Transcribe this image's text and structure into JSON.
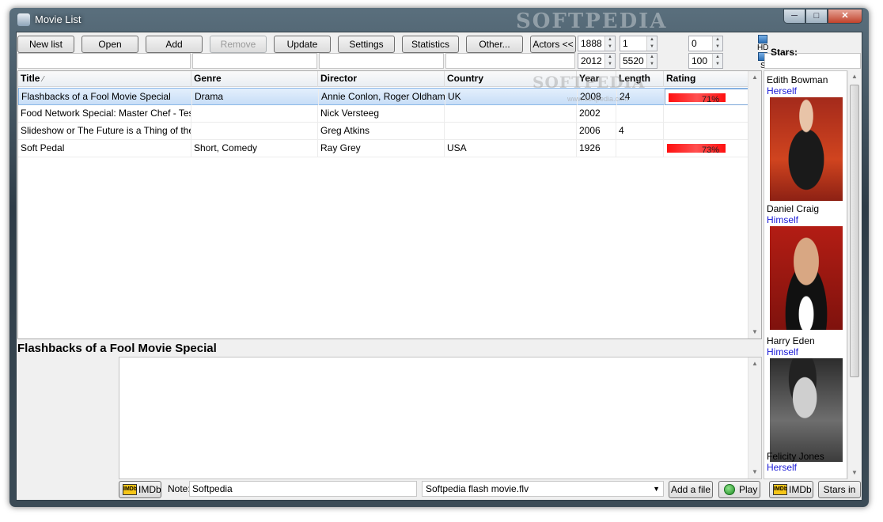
{
  "window": {
    "title": "Movie List",
    "watermark": "SOFTPEDIA",
    "caption": {
      "minimize": "─",
      "maximize": "□",
      "close": "✕"
    }
  },
  "toolbar": {
    "new_list": "New list",
    "open": "Open",
    "add": "Add",
    "remove": "Remove",
    "update": "Update",
    "settings": "Settings",
    "statistics": "Statistics",
    "other": "Other...",
    "actors": "Actors <<"
  },
  "filters": {
    "year_from": "1888",
    "year_to": "2012",
    "length_from": "1",
    "length_to": "5520",
    "rating_from": "0",
    "rating_to": "100",
    "hd_label": "HD",
    "s_label": "S"
  },
  "grid": {
    "columns": [
      "Title",
      "Genre",
      "Director",
      "Country",
      "Year",
      "Length",
      "Rating"
    ],
    "sort_indicator": "⁄",
    "rows": [
      {
        "title": "Flashbacks of a Fool Movie Special",
        "genre": "Drama",
        "director": "Annie Conlon, Roger Oldham",
        "country": "UK",
        "year": "2008",
        "length": "24",
        "rating": "71%",
        "rating_value": 71
      },
      {
        "title": "Food Network Special: Master Chef - Test of",
        "genre": "",
        "director": "Nick Versteeg",
        "country": "",
        "year": "2002",
        "length": "",
        "rating": "",
        "rating_value": 0
      },
      {
        "title": "Slideshow or The Future is a Thing of the",
        "genre": "",
        "director": "Greg Atkins",
        "country": "",
        "year": "2006",
        "length": "4",
        "rating": "",
        "rating_value": 0
      },
      {
        "title": "Soft Pedal",
        "genre": "Short, Comedy",
        "director": "Ray Grey",
        "country": "USA",
        "year": "1926",
        "length": "",
        "rating": "73%",
        "rating_value": 73
      }
    ],
    "watermark": "SOFTPEDIA",
    "watermark_url": "www.softpedia.com"
  },
  "detail": {
    "title": "Flashbacks of a Fool Movie Special",
    "imdb_label": "IMDb",
    "note_label": "Note:",
    "note_value": "Softpedia",
    "file_value": "Softpedia flash movie.flv",
    "add_file": "Add a file",
    "play": "Play"
  },
  "stars": {
    "label": "Stars:",
    "imdb_label": "IMDb",
    "stars_in": "Stars in",
    "items": [
      {
        "name": "Edith Bowman",
        "role": "Herself"
      },
      {
        "name": "Daniel Craig",
        "role": "Himself"
      },
      {
        "name": "Harry Eden",
        "role": "Himself"
      },
      {
        "name": "Felicity Jones",
        "role": "Herself"
      }
    ]
  },
  "colors": {
    "rating_bar": "#ff1010",
    "selection": "#c8def7",
    "role_link": "#1a1ad6"
  }
}
